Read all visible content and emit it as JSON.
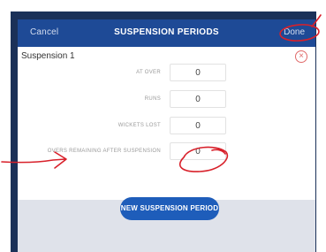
{
  "header": {
    "cancel_label": "Cancel",
    "title": "SUSPENSION PERIODS",
    "done_label": "Done"
  },
  "suspension": {
    "title": "Suspension 1",
    "remove_icon": "close-circle-icon",
    "fields": [
      {
        "label": "AT OVER",
        "value": "0"
      },
      {
        "label": "RUNS",
        "value": "0"
      },
      {
        "label": "WICKETS LOST",
        "value": "0"
      },
      {
        "label": "OVERS REMAINING AFTER SUSPENSION",
        "value": "0"
      }
    ]
  },
  "actions": {
    "new_period_label": "NEW SUSPENSION PERIOD"
  },
  "colors": {
    "header": "#1e4a96",
    "button": "#1e5dba",
    "annotation": "#d8202a"
  }
}
